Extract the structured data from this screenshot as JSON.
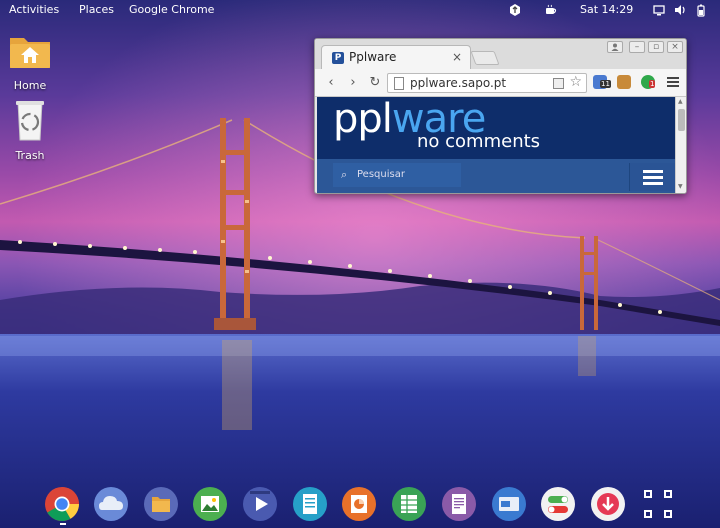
{
  "topbar": {
    "activities": "Activities",
    "places": "Places",
    "app_menu": "Google Chrome",
    "clock": "Sat 14:29",
    "tray_icons": [
      "update-icon",
      "coffee-icon",
      "display-icon",
      "volume-icon",
      "battery-icon"
    ]
  },
  "desktop": {
    "icons": [
      {
        "label": "Home",
        "icon": "home-folder-icon"
      },
      {
        "label": "Trash",
        "icon": "trash-icon"
      }
    ]
  },
  "browser": {
    "tab_title": "Pplware",
    "tab_close": "×",
    "favicon_letter": "P",
    "url": "pplware.sapo.pt",
    "extension_badges": [
      "11",
      "1"
    ],
    "page": {
      "logo_main_a": "ppl",
      "logo_main_b": "ware",
      "logo_sub": "no comments",
      "search_placeholder": "Pesquisar"
    }
  },
  "dock": {
    "items": [
      "chrome-icon",
      "cloud-icon",
      "files-icon",
      "image-viewer-icon",
      "video-player-icon",
      "document-icon",
      "presentation-icon",
      "spreadsheet-icon",
      "text-editor-icon",
      "ereader-icon",
      "settings-toggle-icon",
      "software-center-icon",
      "app-grid-icon"
    ]
  },
  "colors": {
    "brand_dark": "#0e2d6a",
    "brand_light": "#4aa6f0",
    "page_blue": "#2c5797"
  }
}
